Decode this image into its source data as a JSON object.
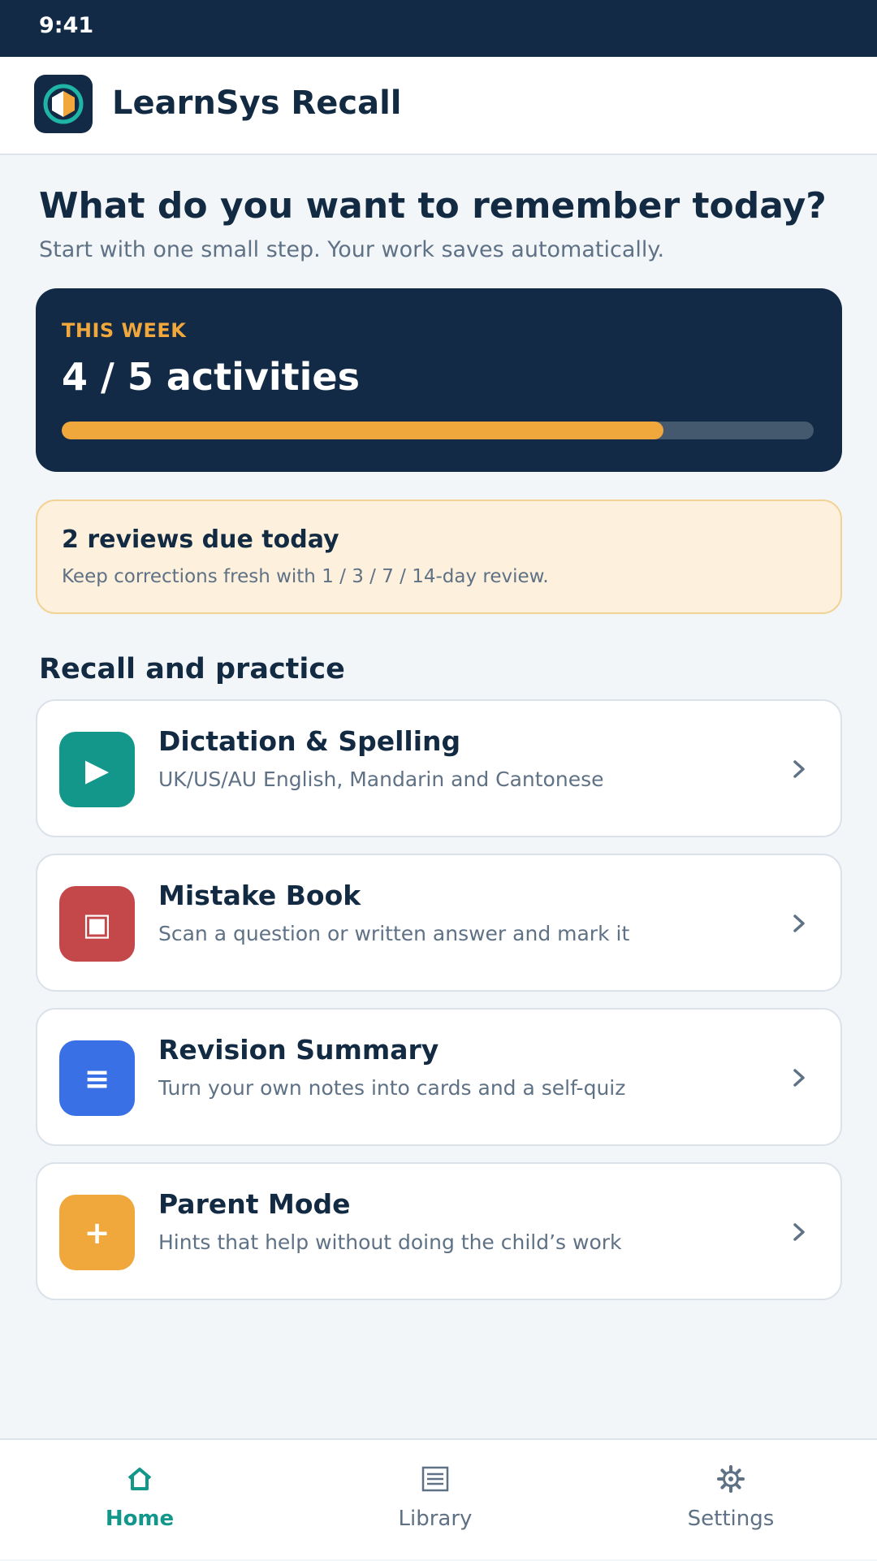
{
  "status_bar": {
    "time": "9:41"
  },
  "header": {
    "app_title": "LearnSys Recall",
    "logo_icon": "learnsys-logo"
  },
  "hero": {
    "title": "What do you want to remember today?",
    "subtitle": "Start with one small step. Your work saves automatically."
  },
  "weekly_progress": {
    "label": "THIS WEEK",
    "value_text": "4 / 5 activities",
    "completed": 4,
    "goal": 5
  },
  "due_banner": {
    "title": "2 reviews due today",
    "subtitle": "Keep corrections fresh with 1 / 3 / 7 / 14-day review."
  },
  "practice": {
    "section_title": "Recall and practice",
    "items": [
      {
        "title": "Dictation & Spelling",
        "subtitle": "UK/US/AU English, Mandarin and Cantonese",
        "icon": "play-icon",
        "glyph": "▶",
        "color": "#12978a"
      },
      {
        "title": "Mistake Book",
        "subtitle": "Scan a question or written answer and mark it",
        "icon": "scan-icon",
        "glyph": "▣",
        "color": "#c4474a"
      },
      {
        "title": "Revision Summary",
        "subtitle": "Turn your own notes into cards and a self-quiz",
        "icon": "notes-icon",
        "glyph": "≡",
        "color": "#3a70e6"
      },
      {
        "title": "Parent Mode",
        "subtitle": "Hints that help without doing the child’s work",
        "icon": "plus-icon",
        "glyph": "+",
        "color": "#f0a73b"
      }
    ]
  },
  "bottom_nav": {
    "items": [
      {
        "label": "Home",
        "icon": "home-icon",
        "active": true
      },
      {
        "label": "Library",
        "icon": "library-icon",
        "active": false
      },
      {
        "label": "Settings",
        "icon": "settings-icon",
        "active": false
      }
    ]
  },
  "colors": {
    "navy": "#122a45",
    "accent_orange": "#f0a73b",
    "teal": "#12978a",
    "text_muted": "#5f7185"
  }
}
